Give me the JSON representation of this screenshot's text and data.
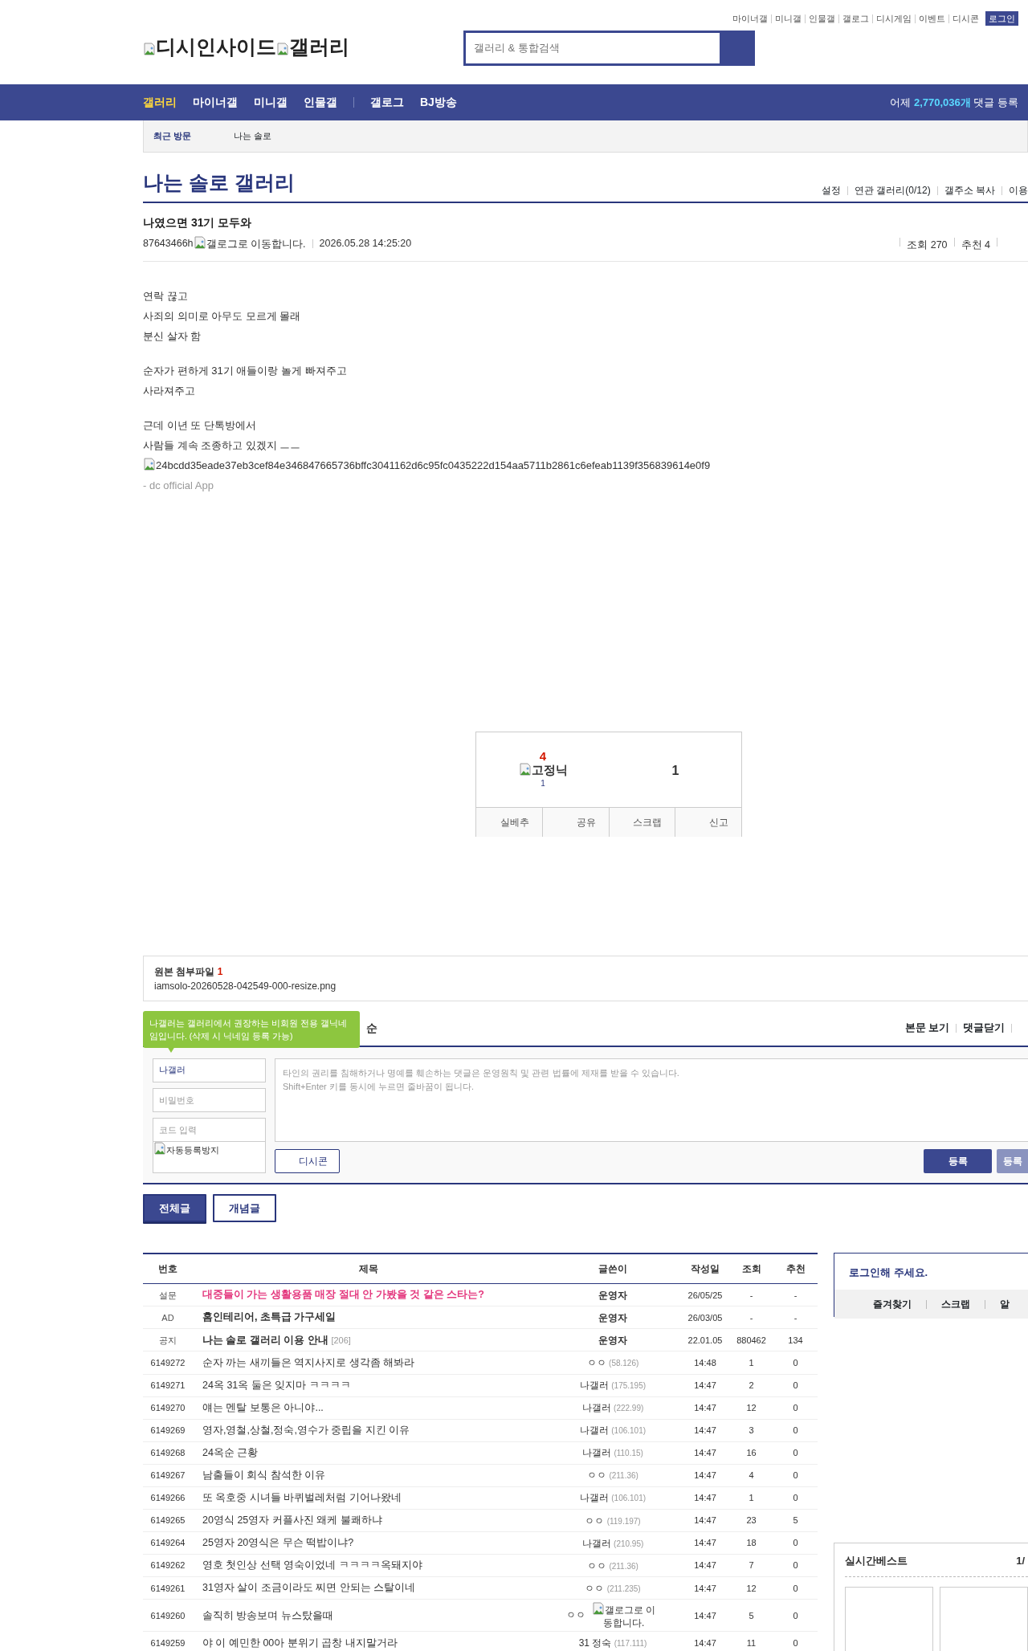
{
  "top_links": [
    "마이너갤",
    "미니갤",
    "인물갤",
    "갤로그",
    "디시게임",
    "이벤트",
    "디시콘"
  ],
  "login_button": "로그인",
  "logo": {
    "site_alt": "디시인사이드",
    "section_alt": "갤러리"
  },
  "search": {
    "placeholder": "갤러리 & 통합검색"
  },
  "nav": {
    "main": [
      {
        "label": "갤러리",
        "selected": true
      },
      {
        "label": "마이너갤",
        "selected": false
      },
      {
        "label": "미니갤",
        "selected": false
      },
      {
        "label": "인물갤",
        "selected": false
      }
    ],
    "extra": [
      {
        "label": "갤로그",
        "selected": false
      },
      {
        "label": "BJ방송",
        "selected": false
      }
    ],
    "stats": {
      "prefix": "어제",
      "count": "2,770,036개",
      "suffix": "댓글 등록"
    }
  },
  "recent": {
    "label": "최근 방문",
    "items": [
      "나는 솔로"
    ]
  },
  "gallery": {
    "title": "나는 솔로 갤러리",
    "links": [
      "설정",
      "연관 갤러리(0/12)",
      "갤주소 복사",
      "이용"
    ]
  },
  "post": {
    "title": "나였으면 31기 모두와",
    "author": "87643466h",
    "author_badge_alt": "갤로그로 이동합니다.",
    "date": "2026.05.28 14:25:20",
    "views": "조회 270",
    "recs": "추천 4",
    "paragraphs": [
      [
        "연락 끊고",
        "사죄의 의미로 아무도 모르게 몰래",
        "분신 살자 함"
      ],
      [
        "순자가 편하게 31기 애들이랑 놀게 빠져주고",
        "사라져주고"
      ],
      [
        "근데 이년 또 단톡방에서",
        "사람들 계속 조종하고 있겠지 ㅡㅡ"
      ]
    ],
    "image_alt": "24bcdd35eade37eb3cef84e346847665736bffc3041162d6c95fc0435222d154aa5711b2861c6efeab1139f356839614e0f9",
    "signature": "- dc official App"
  },
  "vote": {
    "up_count": "4",
    "fixed_alt": "고정닉",
    "fixed_count": "1",
    "down_count": "1",
    "actions": [
      "실베추",
      "공유",
      "스크랩",
      "신고"
    ]
  },
  "attachment": {
    "label": "원본 첨부파일",
    "count": "1",
    "file": "iamsolo-20260528-042549-000-resize.png"
  },
  "comments": {
    "tooltip": "나갤러는 갤러리에서 권장하는 비회원 전용 갤닉네임입니다. (삭제 시 닉네임 등록 가능)",
    "heading_visible": "순",
    "links": [
      "본문 보기",
      "댓글닫기"
    ],
    "form": {
      "nick": "나갤러",
      "password_placeholder": "비밀번호",
      "code_placeholder": "코드 입력",
      "captcha_alt": "자동등록방지",
      "text_placeholder": "타인의 권리를 침해하거나 명예를 훼손하는 댓글은 운영원칙 및 관련 법률에 제재를 받을 수 있습니다.\nShift+Enter 키를 동시에 누르면 줄바꿈이 됩니다.",
      "dccon": "디시콘",
      "submit": [
        {
          "label": "등록",
          "disabled": false
        },
        {
          "label": "등록",
          "disabled": true
        }
      ]
    }
  },
  "list_tabs": [
    {
      "label": "전체글",
      "selected": true
    },
    {
      "label": "개념글",
      "selected": false
    }
  ],
  "table": {
    "columns": [
      "번호",
      "제목",
      "글쓴이",
      "작성일",
      "조회",
      "추천"
    ],
    "rows": [
      {
        "kind": "survey",
        "num": "설문",
        "title": "대중들이 가는 생활용품 매장 절대 안 가봤을 것 같은 스타는?",
        "writer": "운영자",
        "date": "26/05/25",
        "views": "-",
        "recs": "-"
      },
      {
        "kind": "ad",
        "num": "AD",
        "title": "홈인테리어, 초특급 가구세일",
        "writer": "운영자",
        "date": "26/03/05",
        "views": "-",
        "recs": "-"
      },
      {
        "kind": "notice",
        "num": "공지",
        "title": "나는 솔로 갤러리 이용 안내",
        "reply_count": "[206]",
        "writer": "운영자",
        "date": "22.01.05",
        "views": "880462",
        "recs": "134"
      },
      {
        "kind": "post",
        "num": "6149272",
        "title": "순자 까는 새끼들은 역지사지로 생각좀 해봐라",
        "writer": "ㅇㅇ",
        "ip": "(58.126)",
        "date": "14:48",
        "views": "1",
        "recs": "0"
      },
      {
        "kind": "post",
        "num": "6149271",
        "title": "24옥 31옥 둘은 잊지마 ㅋㅋㅋㅋ",
        "writer": "나갤러",
        "ip": "(175.195)",
        "date": "14:47",
        "views": "2",
        "recs": "0"
      },
      {
        "kind": "post",
        "num": "6149270",
        "title": "얘는 멘탈 보통은 아니야...",
        "writer": "나갤러",
        "ip": "(222.99)",
        "date": "14:47",
        "views": "12",
        "recs": "0"
      },
      {
        "kind": "post",
        "num": "6149269",
        "title": "영자,영철,상철,정숙,영수가 중립을 지킨 이유",
        "writer": "나갤러",
        "ip": "(106.101)",
        "date": "14:47",
        "views": "3",
        "recs": "0"
      },
      {
        "kind": "post",
        "num": "6149268",
        "title": "24옥순 근황",
        "writer": "나갤러",
        "ip": "(110.15)",
        "date": "14:47",
        "views": "16",
        "recs": "0"
      },
      {
        "kind": "post",
        "num": "6149267",
        "title": "남출들이 회식 참석한 이유",
        "writer": "ㅇㅇ",
        "ip": "(211.36)",
        "date": "14:47",
        "views": "4",
        "recs": "0"
      },
      {
        "kind": "post",
        "num": "6149266",
        "title": "또 옥호중 시녀들 바퀴벌레처럼 기어나왔네",
        "writer": "나갤러",
        "ip": "(106.101)",
        "date": "14:47",
        "views": "1",
        "recs": "0"
      },
      {
        "kind": "post",
        "num": "6149265",
        "title": "20영식 25영자 커플사진 왜케 불쾌하냐",
        "writer": "ㅇㅇ",
        "ip": "(119.197)",
        "date": "14:47",
        "views": "23",
        "recs": "5"
      },
      {
        "kind": "post",
        "num": "6149264",
        "title": "25영자 20영식은 무슨 떡밥이냐?",
        "writer": "나갤러",
        "ip": "(210.95)",
        "date": "14:47",
        "views": "18",
        "recs": "0"
      },
      {
        "kind": "post",
        "num": "6149262",
        "title": "영호 첫인상 선택 영숙이었네 ㅋㅋㅋㅋ옥돼지야",
        "writer": "ㅇㅇ",
        "ip": "(211.36)",
        "date": "14:47",
        "views": "7",
        "recs": "0"
      },
      {
        "kind": "post",
        "num": "6149261",
        "title": "31영자 살이 조금이라도 찌면 안되는 스탈이네",
        "writer": "ㅇㅇ",
        "ip": "(211.235)",
        "date": "14:47",
        "views": "12",
        "recs": "0"
      },
      {
        "kind": "post",
        "num": "6149260",
        "title": "솔직히 방송보며 뉴스탔을때",
        "writer": "ㅇㅇ",
        "badge_alt": "갤로그로 이동합니다.",
        "date": "14:47",
        "views": "5",
        "recs": "0"
      },
      {
        "kind": "post",
        "num": "6149259",
        "title": "야 이 예민한 00아 분위기 곱창 내지말거라",
        "writer": "31 정숙",
        "ip": "(117.111)",
        "date": "14:47",
        "views": "11",
        "recs": "0"
      }
    ]
  },
  "side": {
    "login_prompt": "로그인해 주세요.",
    "links": [
      "즐겨찾기",
      "스크랩",
      "알"
    ],
    "best_title": "실시간베스트",
    "best_page": "1/"
  }
}
